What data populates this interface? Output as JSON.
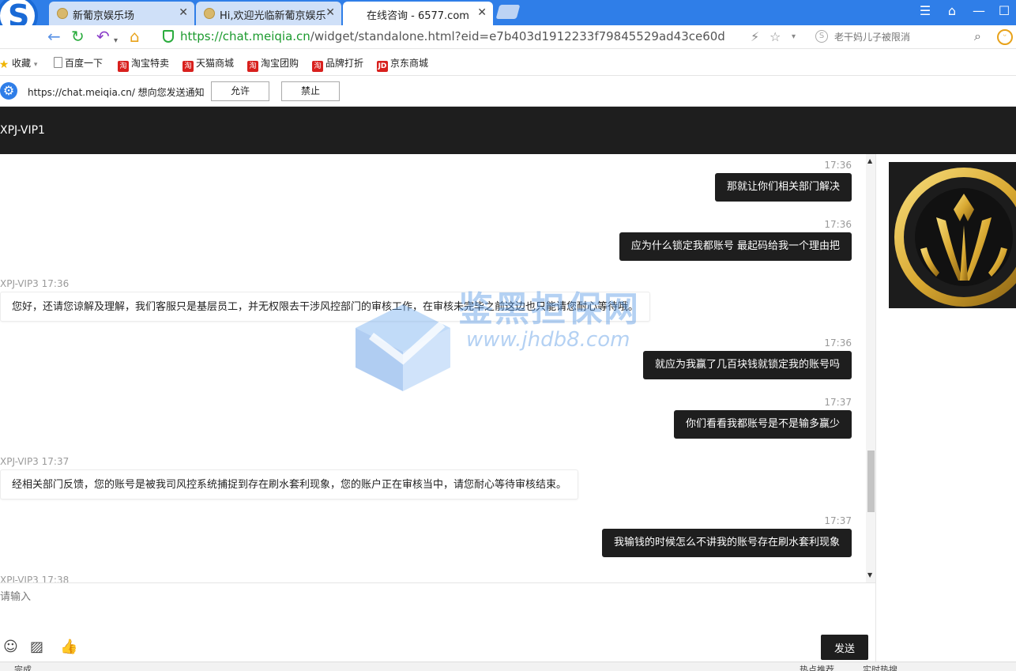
{
  "browser": {
    "tabs": [
      {
        "title": "新葡京娱乐场"
      },
      {
        "title": "Hi,欢迎光临新葡京娱乐"
      },
      {
        "title": "在线咨询 - 6577.com"
      }
    ],
    "address": {
      "scheme": "https://",
      "host": "chat.meiqia.cn",
      "path": "/widget/standalone.html?eid=e7b403d1912233f79845529ad43ce60d"
    },
    "search_placeholder": "老干妈儿子被限消",
    "bookmarks": [
      {
        "label": "收藏",
        "icon": "star-icon"
      },
      {
        "label": "百度一下",
        "icon": "page-icon"
      },
      {
        "label": "淘宝特卖",
        "icon": "taobao-icon"
      },
      {
        "label": "天猫商城",
        "icon": "taobao-icon"
      },
      {
        "label": "淘宝团购",
        "icon": "taobao-icon"
      },
      {
        "label": "品牌打折",
        "icon": "taobao-icon"
      },
      {
        "label": "京东商城",
        "icon": "jd-icon"
      }
    ],
    "notification": {
      "text": "https://chat.meiqia.cn/ 想向您发送通知",
      "allow": "允许",
      "deny": "禁止"
    },
    "status": {
      "left": "完成",
      "hot": "热点推荐",
      "live": "实时热搜"
    }
  },
  "chat": {
    "title": "XPJ-VIP1",
    "messages": [
      {
        "side": "right",
        "time": "17:36",
        "text": "那就让你们相关部门解决"
      },
      {
        "side": "right",
        "time": "17:36",
        "text": "应为什么锁定我都账号 最起码给我一个理由把"
      },
      {
        "side": "left",
        "sender": "XPJ-VIP3 17:36",
        "text": "您好，还请您谅解及理解，我们客服只是基层员工，并无权限去干涉风控部门的审核工作，在审核未完毕之前这边也只能请您耐心等待哦。"
      },
      {
        "side": "right",
        "time": "17:36",
        "text": "就应为我赢了几百块钱就锁定我的账号吗"
      },
      {
        "side": "right",
        "time": "17:37",
        "text": "你们看看我都账号是不是输多赢少"
      },
      {
        "side": "left",
        "sender": "XPJ-VIP3 17:37",
        "text": "经相关部门反馈，您的账号是被我司风控系统捕捉到存在刷水套利现象，您的账户正在审核当中，请您耐心等待审核结束。"
      },
      {
        "side": "right",
        "time": "17:37",
        "text": "我输钱的时候怎么不讲我的账号存在刷水套利现象"
      },
      {
        "side": "left",
        "sender": "XPJ-VIP3 17:38",
        "text": ""
      }
    ],
    "input_placeholder": "请输入",
    "send_label": "发送"
  },
  "watermark": {
    "cn": "鉴黑担保网",
    "url": "www.jhdb8.com"
  },
  "colors": {
    "tabbar": "#2f7ee8",
    "chat_dark": "#1e1e1e",
    "url_green": "#1c9a2e",
    "logo_gold": "#d9b24a"
  }
}
